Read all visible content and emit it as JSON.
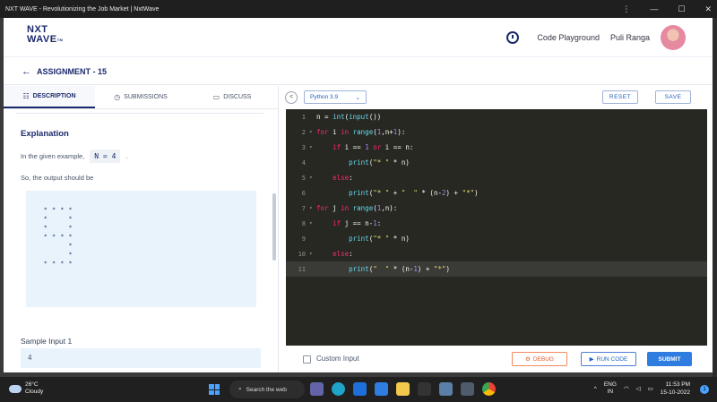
{
  "window": {
    "title": "NXT WAVE - Revolutionizing the Job Market | NxtWave",
    "menu_icon": "⋮",
    "min_icon": "—",
    "max_icon": "☐",
    "close_icon": "✕"
  },
  "header": {
    "logo_line1": "NXT",
    "logo_line2": "WAVE",
    "logo_tm": "TM",
    "code_playground": "Code Playground",
    "user_name": "Puli Ranga"
  },
  "assignment": {
    "back_icon": "←",
    "title": "ASSIGNMENT - 15"
  },
  "tabs": [
    {
      "icon": "☷",
      "label": "DESCRIPTION",
      "active": true
    },
    {
      "icon": "◷",
      "label": "SUBMISSIONS",
      "active": false
    },
    {
      "icon": "▭",
      "label": "DISCUSS",
      "active": false
    }
  ],
  "description": {
    "heading": "Explanation",
    "example_text": "In the given example,",
    "example_code": "N = 4",
    "example_end": ".",
    "output_text": "So, the output should be",
    "pattern": "* * * *\n*     *\n*     *\n* * * *\n      *\n      *\n* * * *",
    "sample_input_title": "Sample Input 1",
    "sample_input_value": "4"
  },
  "editor": {
    "collapse_icon": "<",
    "language": "Python 3.9",
    "language_caret": "⌄",
    "reset_label": "RESET",
    "save_label": "SAVE",
    "lines": [
      {
        "no": "1",
        "fold": "",
        "code": "n = int(input())"
      },
      {
        "no": "2",
        "fold": "▾",
        "code": "for i in range(1,n+1):"
      },
      {
        "no": "3",
        "fold": "▾",
        "code": "    if i == 1 or i == n:"
      },
      {
        "no": "4",
        "fold": "",
        "code": "        print(\"* \" * n)"
      },
      {
        "no": "5",
        "fold": "▾",
        "code": "    else:"
      },
      {
        "no": "6",
        "fold": "",
        "code": "        print(\"* \" + \"  \" * (n-2) + \"*\")"
      },
      {
        "no": "7",
        "fold": "▾",
        "code": "for j in range(1,n):"
      },
      {
        "no": "8",
        "fold": "▾",
        "code": "    if j == n-1:"
      },
      {
        "no": "9",
        "fold": "",
        "code": "        print(\"* \" * n)"
      },
      {
        "no": "10",
        "fold": "▾",
        "code": "    else:"
      },
      {
        "no": "11",
        "fold": "",
        "code": "        print(\"  \" * (n-1) + \"*\")"
      }
    ],
    "current_line": 11,
    "custom_input_label": "Custom Input",
    "debug_icon": "⚙",
    "debug_label": "DEBUG",
    "run_icon": "▶",
    "run_label": "RUN CODE",
    "submit_label": "SUBMIT"
  },
  "taskbar": {
    "temp": "26°C",
    "weather": "Cloudy",
    "search_icon": "⌕",
    "search_label": "Search the web",
    "tray_caret": "^",
    "lang_line1": "ENG",
    "lang_line2": "IN",
    "time": "11:53 PM",
    "date": "15-10-2022",
    "notif_count": "1"
  },
  "colors": {
    "brand": "#1b2a6b",
    "accent": "#2f7de1",
    "debug": "#e0592a",
    "editor_bg": "#272822"
  }
}
